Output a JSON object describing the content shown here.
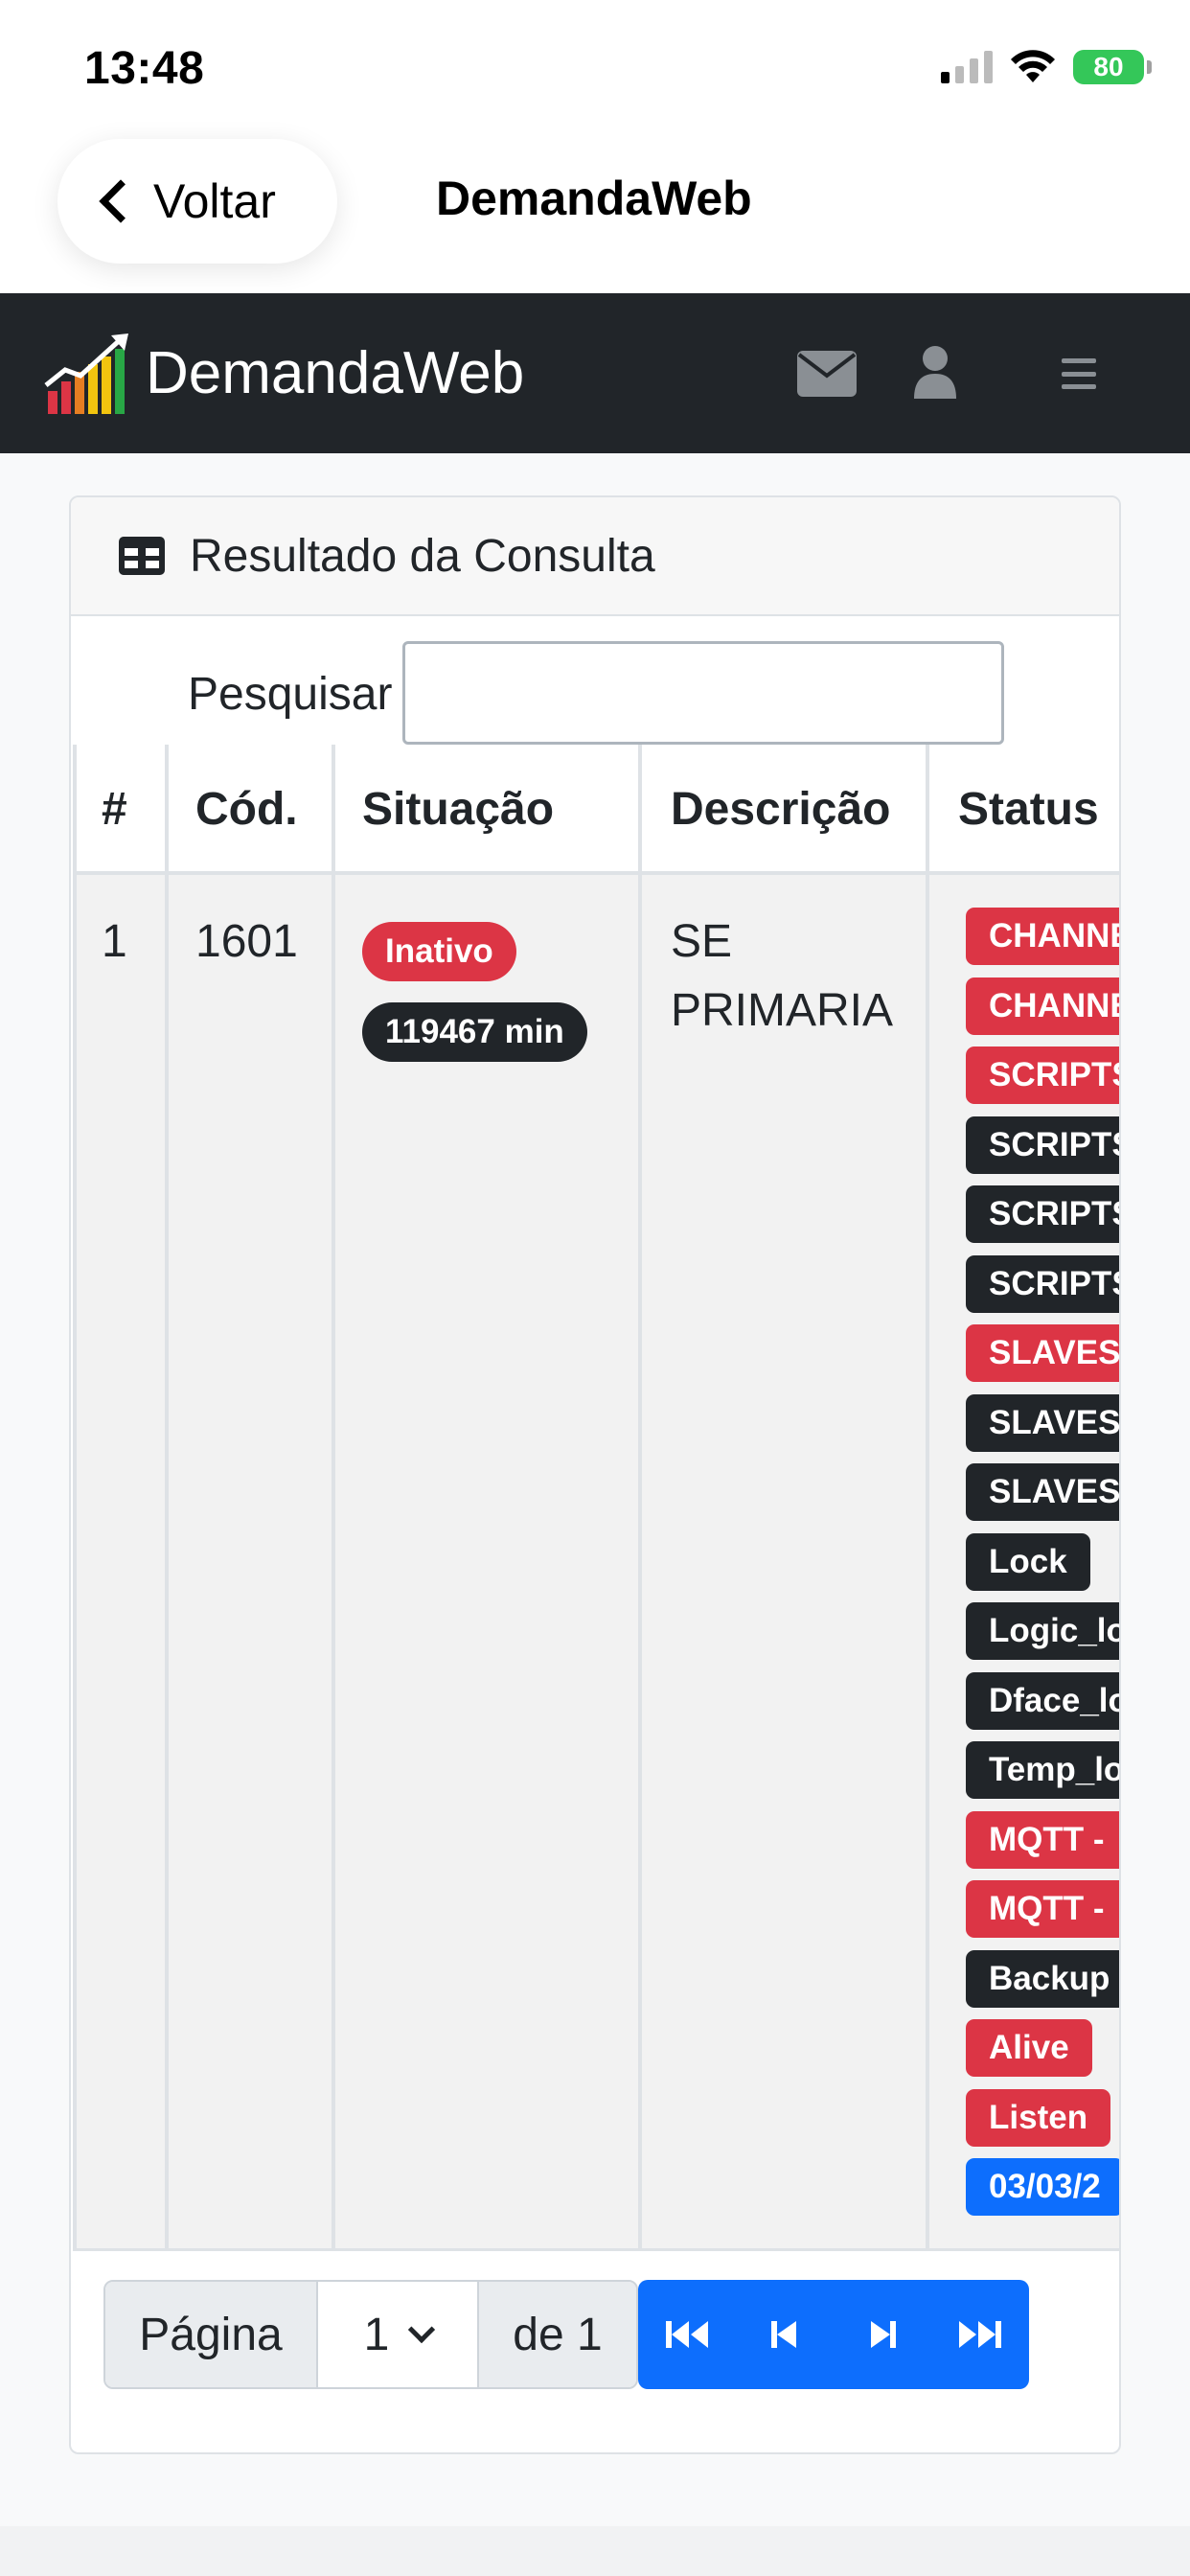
{
  "status_bar": {
    "time": "13:48",
    "battery": "80"
  },
  "ios_nav": {
    "back_label": "Voltar",
    "title": "DemandaWeb"
  },
  "navbar": {
    "brand": "DemandaWeb"
  },
  "card": {
    "title": "Resultado da Consulta",
    "search": {
      "label": "Pesquisar",
      "value": "",
      "placeholder": ""
    }
  },
  "table": {
    "headers": [
      "#",
      "Cód.",
      "Situação",
      "Descrição",
      "Status"
    ],
    "rows": [
      {
        "index": "1",
        "code": "1601",
        "situacao": "Inativo",
        "tempo": "119467 min",
        "descricao_line1": "SE",
        "descricao_line2": "PRIMARIA",
        "status": [
          {
            "text": "CHANNEL",
            "color": "danger"
          },
          {
            "text": "CHANNEL",
            "color": "danger"
          },
          {
            "text": "SCRIPTS",
            "color": "danger"
          },
          {
            "text": "SCRIPTS",
            "color": "dark"
          },
          {
            "text": "SCRIPTS",
            "color": "dark"
          },
          {
            "text": "SCRIPTS",
            "color": "dark"
          },
          {
            "text": "SLAVES",
            "color": "danger"
          },
          {
            "text": "SLAVES",
            "color": "dark"
          },
          {
            "text": "SLAVES",
            "color": "dark"
          },
          {
            "text": "Lock",
            "color": "dark"
          },
          {
            "text": "Logic_lock",
            "color": "dark"
          },
          {
            "text": "Dface_lock",
            "color": "dark"
          },
          {
            "text": "Temp_lock",
            "color": "dark"
          },
          {
            "text": "MQTT - ",
            "color": "danger"
          },
          {
            "text": "MQTT - ",
            "color": "danger"
          },
          {
            "text": "Backup",
            "color": "dark"
          },
          {
            "text": "Alive",
            "color": "danger"
          },
          {
            "text": "Listen",
            "color": "danger"
          },
          {
            "text": "03/03/2",
            "color": "primary"
          }
        ]
      }
    ]
  },
  "pagination": {
    "page_label": "Página",
    "page_value": "1",
    "of_label": "de 1"
  },
  "colors": {
    "danger": "#dc3545",
    "dark": "#212529",
    "primary": "#0d6efd",
    "navbar": "#212529"
  }
}
